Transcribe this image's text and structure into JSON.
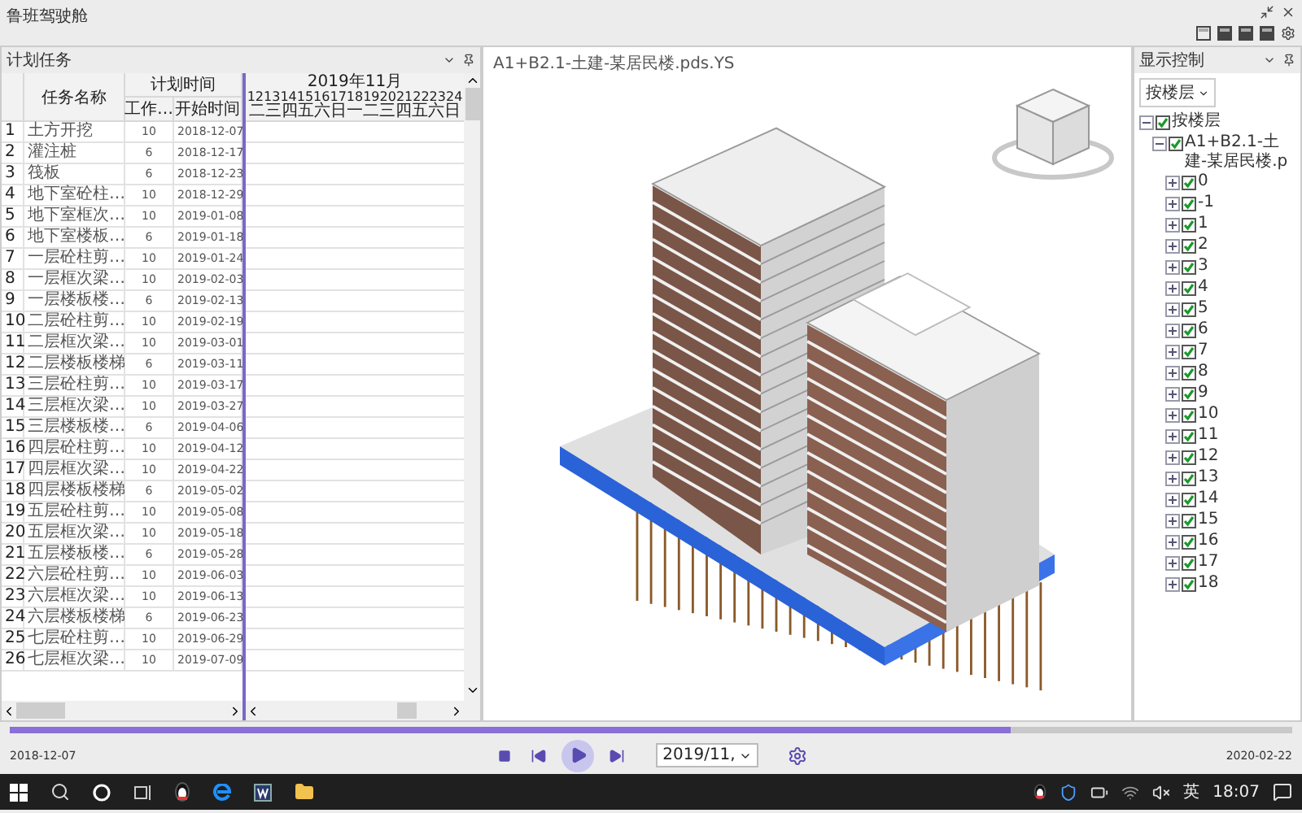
{
  "app_title": "鲁班驾驶舱",
  "left_panel": {
    "title": "计划任务",
    "headers": {
      "name": "任务名称",
      "group": "计划时间",
      "work": "工作…",
      "start": "开始时间"
    },
    "calendar": {
      "month": "2019年11月",
      "days": "12131415161718192021222324",
      "weekdays": "二三四五六日一二三四五六日"
    },
    "tasks": [
      {
        "no": "1",
        "name": "土方开挖",
        "work": "10",
        "start": "2018-12-07"
      },
      {
        "no": "2",
        "name": "灌注桩",
        "work": "6",
        "start": "2018-12-17"
      },
      {
        "no": "3",
        "name": "筏板",
        "work": "6",
        "start": "2018-12-23"
      },
      {
        "no": "4",
        "name": "地下室砼柱…",
        "work": "10",
        "start": "2018-12-29"
      },
      {
        "no": "5",
        "name": "地下室框次…",
        "work": "10",
        "start": "2019-01-08"
      },
      {
        "no": "6",
        "name": "地下室楼板…",
        "work": "6",
        "start": "2019-01-18"
      },
      {
        "no": "7",
        "name": "一层砼柱剪…",
        "work": "10",
        "start": "2019-01-24"
      },
      {
        "no": "8",
        "name": "一层框次梁…",
        "work": "10",
        "start": "2019-02-03"
      },
      {
        "no": "9",
        "name": "一层楼板楼…",
        "work": "6",
        "start": "2019-02-13"
      },
      {
        "no": "10",
        "name": "二层砼柱剪…",
        "work": "10",
        "start": "2019-02-19"
      },
      {
        "no": "11",
        "name": "二层框次梁…",
        "work": "10",
        "start": "2019-03-01"
      },
      {
        "no": "12",
        "name": "二层楼板楼梯",
        "work": "6",
        "start": "2019-03-11"
      },
      {
        "no": "13",
        "name": "三层砼柱剪…",
        "work": "10",
        "start": "2019-03-17"
      },
      {
        "no": "14",
        "name": "三层框次梁…",
        "work": "10",
        "start": "2019-03-27"
      },
      {
        "no": "15",
        "name": "三层楼板楼…",
        "work": "6",
        "start": "2019-04-06"
      },
      {
        "no": "16",
        "name": "四层砼柱剪…",
        "work": "10",
        "start": "2019-04-12"
      },
      {
        "no": "17",
        "name": "四层框次梁…",
        "work": "10",
        "start": "2019-04-22"
      },
      {
        "no": "18",
        "name": "四层楼板楼梯",
        "work": "6",
        "start": "2019-05-02"
      },
      {
        "no": "19",
        "name": "五层砼柱剪…",
        "work": "10",
        "start": "2019-05-08"
      },
      {
        "no": "20",
        "name": "五层框次梁…",
        "work": "10",
        "start": "2019-05-18"
      },
      {
        "no": "21",
        "name": "五层楼板楼…",
        "work": "6",
        "start": "2019-05-28"
      },
      {
        "no": "22",
        "name": "六层砼柱剪…",
        "work": "10",
        "start": "2019-06-03"
      },
      {
        "no": "23",
        "name": "六层框次梁…",
        "work": "10",
        "start": "2019-06-13"
      },
      {
        "no": "24",
        "name": "六层楼板楼梯",
        "work": "6",
        "start": "2019-06-23"
      },
      {
        "no": "25",
        "name": "七层砼柱剪…",
        "work": "10",
        "start": "2019-06-29"
      },
      {
        "no": "26",
        "name": "七层框次梁…",
        "work": "10",
        "start": "2019-07-09"
      }
    ]
  },
  "viewport": {
    "title": "A1+B2.1-土建-某居民楼.pds.YS"
  },
  "right_panel": {
    "title": "显示控制",
    "group_by": "按楼层",
    "tree": [
      {
        "label": "按楼层",
        "checked": true,
        "expanded": true,
        "children": [
          {
            "label": "A1+B2.1-土建-某居民楼.p",
            "checked": true,
            "expanded": true,
            "children": [
              {
                "label": "0",
                "checked": true,
                "expanded": false
              },
              {
                "label": "-1",
                "checked": true,
                "expanded": false
              },
              {
                "label": "1",
                "checked": true,
                "expanded": false
              },
              {
                "label": "2",
                "checked": true,
                "expanded": false
              },
              {
                "label": "3",
                "checked": true,
                "expanded": false
              },
              {
                "label": "4",
                "checked": true,
                "expanded": false
              },
              {
                "label": "5",
                "checked": true,
                "expanded": false
              },
              {
                "label": "6",
                "checked": true,
                "expanded": false
              },
              {
                "label": "7",
                "checked": true,
                "expanded": false
              },
              {
                "label": "8",
                "checked": true,
                "expanded": false
              },
              {
                "label": "9",
                "checked": true,
                "expanded": false
              },
              {
                "label": "10",
                "checked": true,
                "expanded": false
              },
              {
                "label": "11",
                "checked": true,
                "expanded": false
              },
              {
                "label": "12",
                "checked": true,
                "expanded": false
              },
              {
                "label": "13",
                "checked": true,
                "expanded": false
              },
              {
                "label": "14",
                "checked": true,
                "expanded": false
              },
              {
                "label": "15",
                "checked": true,
                "expanded": false
              },
              {
                "label": "16",
                "checked": true,
                "expanded": false
              },
              {
                "label": "17",
                "checked": true,
                "expanded": false
              },
              {
                "label": "18",
                "checked": true,
                "expanded": false
              }
            ]
          }
        ]
      }
    ]
  },
  "timeline": {
    "start": "2018-12-07",
    "end": "2020-02-22",
    "level": 0.78,
    "date": "2019/11,"
  },
  "taskbar": {
    "ime": "英",
    "clock": "18:07"
  }
}
